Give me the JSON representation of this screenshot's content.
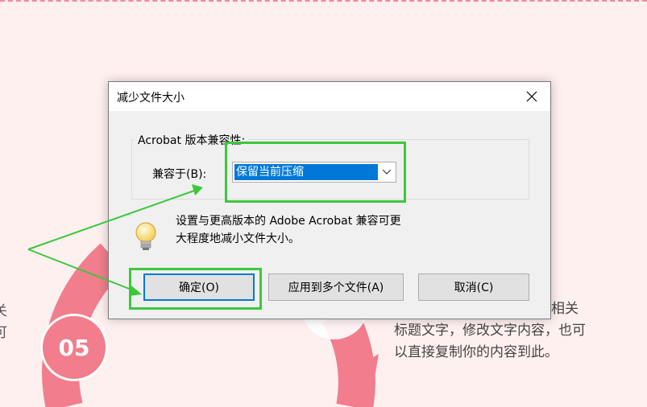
{
  "background": {
    "circle_number": "05",
    "right_text_line1": "添加相关",
    "right_text_line2": "标题文字，修改文字内容，也可",
    "right_text_line3": "以直接复制你的内容到此。",
    "left_text_line1": "关",
    "left_text_line2": "可"
  },
  "dialog": {
    "title": "减少文件大小",
    "group_label": "Acrobat 版本兼容性:",
    "compat_label": "兼容于(B):",
    "select_value": "保留当前压缩",
    "info_line1": "设置与更高版本的 Adobe Acrobat 兼容可更",
    "info_line2": "大程度地减小文件大小。",
    "ok_label": "确定(O)",
    "apply_label": "应用到多个文件(A)",
    "cancel_label": "取消(C)"
  },
  "colors": {
    "highlight": "#3cc83c",
    "selection": "#0078d7",
    "accent_pink": "#f27d8c"
  }
}
